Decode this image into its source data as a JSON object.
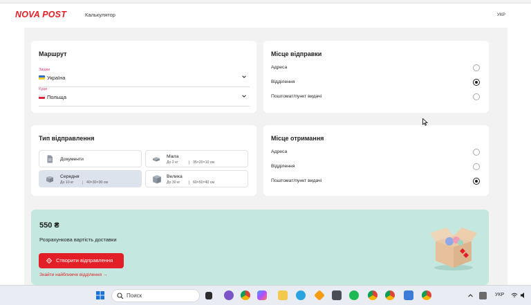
{
  "header": {
    "logo": "NOVA POST",
    "nav_calculator": "Калькулятор",
    "language": "УКР"
  },
  "route": {
    "title": "Маршрут",
    "from": {
      "label": "Звідки",
      "value": "Україна"
    },
    "to": {
      "label": "Куди",
      "value": "Польща"
    }
  },
  "dispatch": {
    "title": "Місце відправки",
    "options": [
      {
        "label": "Адреса",
        "selected": false
      },
      {
        "label": "Відділення",
        "selected": true
      },
      {
        "label": "Поштомат/пункт видачі",
        "selected": false
      }
    ]
  },
  "shipment_type": {
    "title": "Тип відправлення",
    "tiles": [
      {
        "name": "Документи",
        "weight": "",
        "dims": "",
        "selected": false,
        "icon": "document-icon"
      },
      {
        "name": "Мала",
        "weight": "До 2 кг",
        "dims": "35×20×10 см",
        "selected": false,
        "icon": "small-parcel-icon"
      },
      {
        "name": "Середня",
        "weight": "До 10 кг",
        "dims": "40×30×30 см",
        "selected": true,
        "icon": "medium-box-icon"
      },
      {
        "name": "Велика",
        "weight": "До 30 кг",
        "dims": "60×50×40 см",
        "selected": false,
        "icon": "large-box-icon"
      }
    ]
  },
  "receive": {
    "title": "Місце отримання",
    "options": [
      {
        "label": "Адреса",
        "selected": false
      },
      {
        "label": "Відділення",
        "selected": false
      },
      {
        "label": "Поштомат/пункт видачі",
        "selected": true
      }
    ]
  },
  "cost": {
    "price": "550 ₴",
    "description": "Розрахункова вартість доставки",
    "create_button": "Створити відправлення",
    "find_link": "Знайти найближче відділення →"
  },
  "taskbar": {
    "search_placeholder": "Поиск",
    "language": "УКР"
  },
  "colors": {
    "brand_red": "#e21e26",
    "cost_bg": "#c4e7df",
    "selected_tile": "#dde3ec"
  }
}
